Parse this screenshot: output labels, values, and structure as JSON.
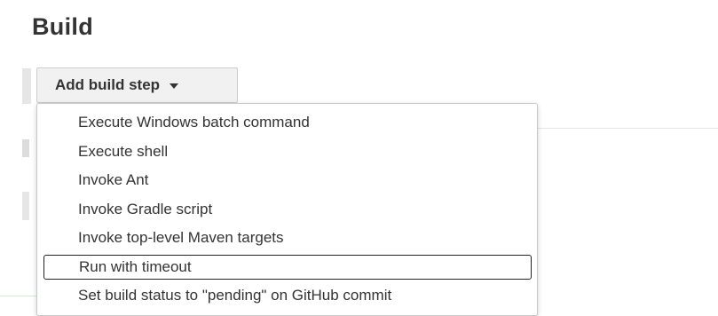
{
  "section": {
    "title": "Build"
  },
  "add_step": {
    "label": "Add build step",
    "caret_icon": "caret-down-icon"
  },
  "dropdown": {
    "focused_index": 5,
    "items": [
      {
        "label": "Execute Windows batch command"
      },
      {
        "label": "Execute shell"
      },
      {
        "label": "Invoke Ant"
      },
      {
        "label": "Invoke Gradle script"
      },
      {
        "label": "Invoke top-level Maven targets"
      },
      {
        "label": "Run with timeout"
      },
      {
        "label": "Set build status to \"pending\" on GitHub commit"
      }
    ]
  }
}
